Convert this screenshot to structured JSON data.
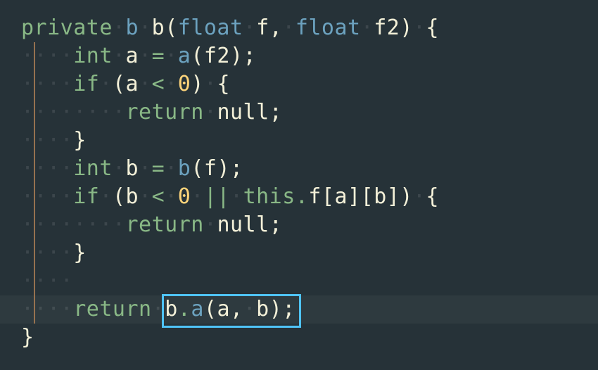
{
  "colors": {
    "background": "#263238",
    "keyword": "#89b886",
    "type": "#6ca2bf",
    "identifier": "#f3f0d8",
    "number": "#fdd47a",
    "guide": "#a97d54",
    "selection_box": "#4fc3f7"
  },
  "highlighted_line_index": 10,
  "selection_box": {
    "line_index": 10,
    "text": "b.a(a, b);"
  },
  "code": {
    "lines": [
      {
        "tokens": [
          {
            "t": "private",
            "c": "kw"
          },
          {
            "t": " ",
            "c": "ws"
          },
          {
            "t": "b",
            "c": "type"
          },
          {
            "t": " ",
            "c": "ws"
          },
          {
            "t": "b",
            "c": "ident"
          },
          {
            "t": "(",
            "c": "punct"
          },
          {
            "t": "float",
            "c": "type"
          },
          {
            "t": " ",
            "c": "ws"
          },
          {
            "t": "f",
            "c": "ident"
          },
          {
            "t": ",",
            "c": "punct"
          },
          {
            "t": " ",
            "c": "ws"
          },
          {
            "t": "float",
            "c": "type"
          },
          {
            "t": " ",
            "c": "ws"
          },
          {
            "t": "f2",
            "c": "ident"
          },
          {
            "t": ")",
            "c": "punct"
          },
          {
            "t": " ",
            "c": "ws"
          },
          {
            "t": "{",
            "c": "punct"
          }
        ],
        "indent": 0
      },
      {
        "tokens": [
          {
            "t": "int",
            "c": "kw"
          },
          {
            "t": " ",
            "c": "ws"
          },
          {
            "t": "a",
            "c": "ident"
          },
          {
            "t": " ",
            "c": "ws"
          },
          {
            "t": "=",
            "c": "op"
          },
          {
            "t": " ",
            "c": "ws"
          },
          {
            "t": "a",
            "c": "func"
          },
          {
            "t": "(",
            "c": "punct"
          },
          {
            "t": "f2",
            "c": "ident"
          },
          {
            "t": ")",
            "c": "punct"
          },
          {
            "t": ";",
            "c": "punct"
          }
        ],
        "indent": 1
      },
      {
        "tokens": [
          {
            "t": "if",
            "c": "kw"
          },
          {
            "t": " ",
            "c": "ws"
          },
          {
            "t": "(",
            "c": "punct"
          },
          {
            "t": "a",
            "c": "ident"
          },
          {
            "t": " ",
            "c": "ws"
          },
          {
            "t": "<",
            "c": "op"
          },
          {
            "t": " ",
            "c": "ws"
          },
          {
            "t": "0",
            "c": "num"
          },
          {
            "t": ")",
            "c": "punct"
          },
          {
            "t": " ",
            "c": "ws"
          },
          {
            "t": "{",
            "c": "punct"
          }
        ],
        "indent": 1
      },
      {
        "tokens": [
          {
            "t": "return",
            "c": "kw"
          },
          {
            "t": " ",
            "c": "ws"
          },
          {
            "t": "null",
            "c": "null"
          },
          {
            "t": ";",
            "c": "punct"
          }
        ],
        "indent": 2
      },
      {
        "tokens": [
          {
            "t": "}",
            "c": "punct"
          }
        ],
        "indent": 1
      },
      {
        "tokens": [
          {
            "t": "int",
            "c": "kw"
          },
          {
            "t": " ",
            "c": "ws"
          },
          {
            "t": "b",
            "c": "ident"
          },
          {
            "t": " ",
            "c": "ws"
          },
          {
            "t": "=",
            "c": "op"
          },
          {
            "t": " ",
            "c": "ws"
          },
          {
            "t": "b",
            "c": "func"
          },
          {
            "t": "(",
            "c": "punct"
          },
          {
            "t": "f",
            "c": "ident"
          },
          {
            "t": ")",
            "c": "punct"
          },
          {
            "t": ";",
            "c": "punct"
          }
        ],
        "indent": 1
      },
      {
        "tokens": [
          {
            "t": "if",
            "c": "kw"
          },
          {
            "t": " ",
            "c": "ws"
          },
          {
            "t": "(",
            "c": "punct"
          },
          {
            "t": "b",
            "c": "ident"
          },
          {
            "t": " ",
            "c": "ws"
          },
          {
            "t": "<",
            "c": "op"
          },
          {
            "t": " ",
            "c": "ws"
          },
          {
            "t": "0",
            "c": "num"
          },
          {
            "t": " ",
            "c": "ws"
          },
          {
            "t": "||",
            "c": "op"
          },
          {
            "t": " ",
            "c": "ws"
          },
          {
            "t": "this",
            "c": "kw"
          },
          {
            "t": ".",
            "c": "op"
          },
          {
            "t": "f",
            "c": "ident"
          },
          {
            "t": "[",
            "c": "punct"
          },
          {
            "t": "a",
            "c": "ident"
          },
          {
            "t": "]",
            "c": "punct"
          },
          {
            "t": "[",
            "c": "punct"
          },
          {
            "t": "b",
            "c": "ident"
          },
          {
            "t": "]",
            "c": "punct"
          },
          {
            "t": ")",
            "c": "punct"
          },
          {
            "t": " ",
            "c": "ws"
          },
          {
            "t": "{",
            "c": "punct"
          }
        ],
        "indent": 1
      },
      {
        "tokens": [
          {
            "t": "return",
            "c": "kw"
          },
          {
            "t": " ",
            "c": "ws"
          },
          {
            "t": "null",
            "c": "null"
          },
          {
            "t": ";",
            "c": "punct"
          }
        ],
        "indent": 2
      },
      {
        "tokens": [
          {
            "t": "}",
            "c": "punct"
          }
        ],
        "indent": 1
      },
      {
        "tokens": [],
        "indent": 1,
        "blank_after_indent": true
      },
      {
        "tokens": [
          {
            "t": "return",
            "c": "kw"
          },
          {
            "t": " ",
            "c": "ws"
          },
          {
            "t": "b",
            "c": "ident"
          },
          {
            "t": ".",
            "c": "op"
          },
          {
            "t": "a",
            "c": "func"
          },
          {
            "t": "(",
            "c": "punct"
          },
          {
            "t": "a",
            "c": "ident"
          },
          {
            "t": ",",
            "c": "punct"
          },
          {
            "t": " ",
            "c": "ws"
          },
          {
            "t": "b",
            "c": "ident"
          },
          {
            "t": ")",
            "c": "punct"
          },
          {
            "t": ";",
            "c": "punct"
          }
        ],
        "indent": 1
      },
      {
        "tokens": [
          {
            "t": "}",
            "c": "punct"
          }
        ],
        "indent": 0
      }
    ]
  }
}
